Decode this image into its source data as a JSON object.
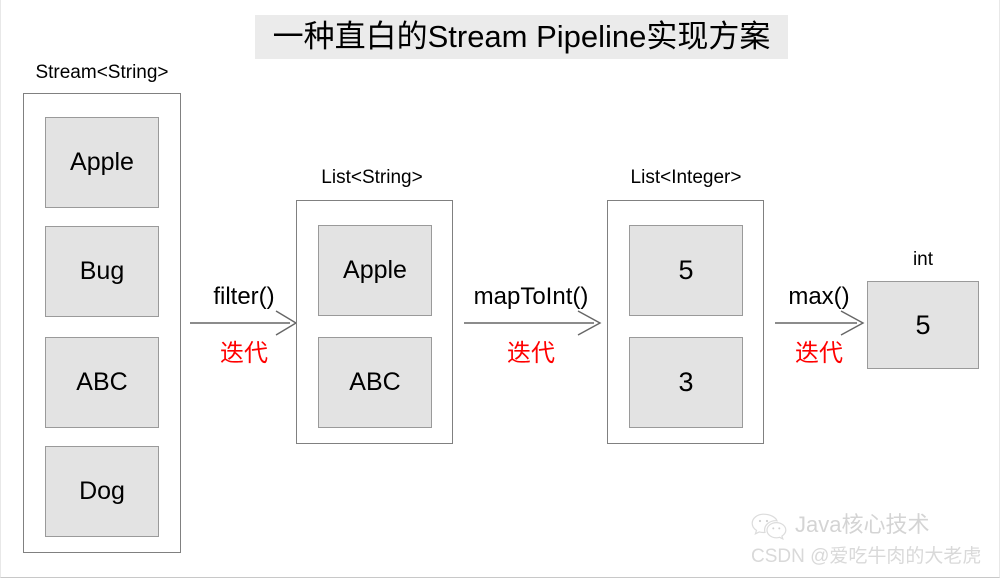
{
  "title": "一种直白的Stream Pipeline实现方案",
  "stages": [
    {
      "label": "Stream<String>",
      "items": [
        "Apple",
        "Bug",
        "ABC",
        "Dog"
      ]
    },
    {
      "label": "List<String>",
      "items": [
        "Apple",
        "ABC"
      ]
    },
    {
      "label": "List<Integer>",
      "items": [
        "5",
        "3"
      ]
    },
    {
      "label": "int",
      "items": [
        "5"
      ]
    }
  ],
  "operations": [
    {
      "name": "filter()",
      "note": "迭代"
    },
    {
      "name": "mapToInt()",
      "note": "迭代"
    },
    {
      "name": "max()",
      "note": "迭代"
    }
  ],
  "watermark": {
    "icon": "wechat-icon",
    "brand": "Java核心技术",
    "attribution": "CSDN @爱吃牛肉的大老虎"
  },
  "colors": {
    "title_highlight": "#ebebeb",
    "item_fill": "#e3e3e3",
    "item_border": "#9a9a9a",
    "container_border": "#808080",
    "note_color": "#ff0000",
    "arrow_color": "#666666"
  }
}
